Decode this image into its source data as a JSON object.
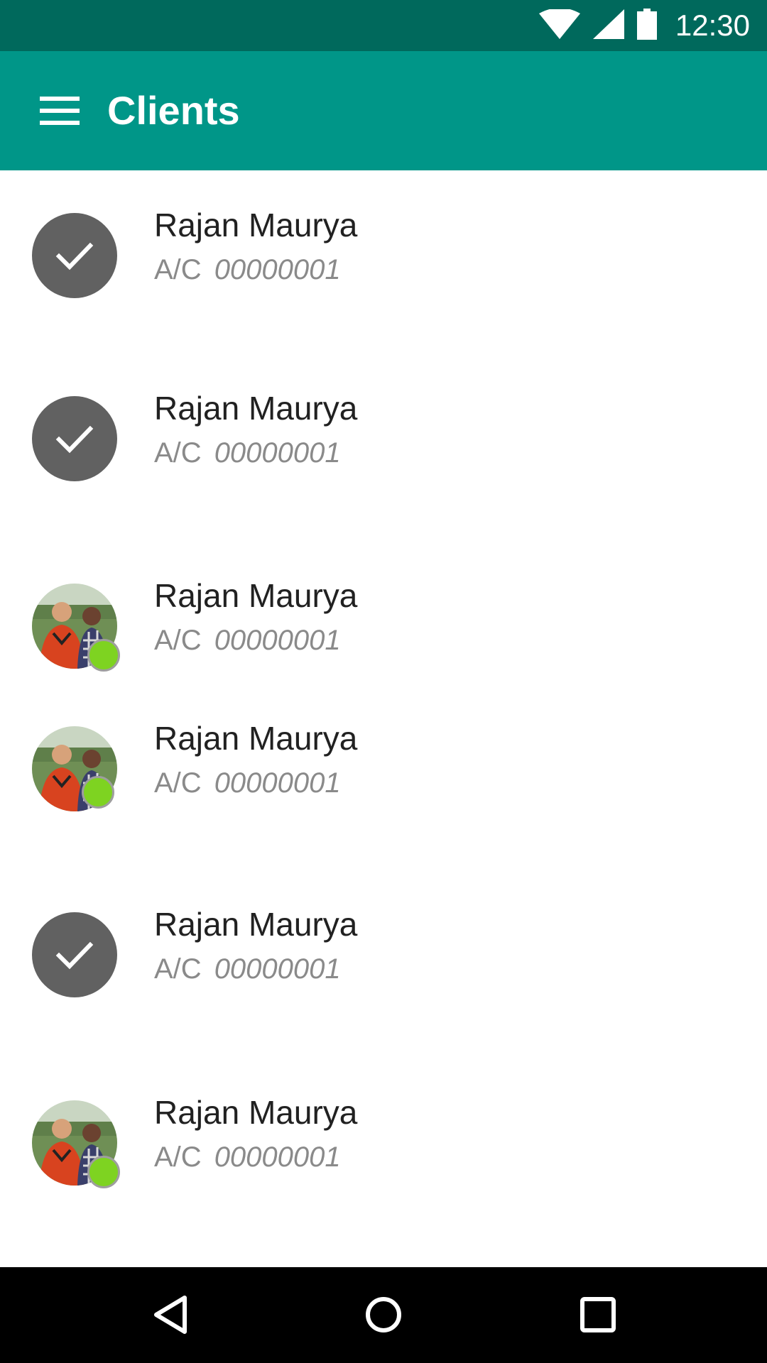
{
  "status_bar": {
    "time": "12:30",
    "icons": [
      "wifi-icon",
      "cell-signal-icon",
      "battery-icon"
    ],
    "background": "#00695C"
  },
  "app_bar": {
    "title": "Clients",
    "menu_icon": "hamburger-menu-icon",
    "background": "#009688"
  },
  "clients": [
    {
      "name": "Rajan Maurya",
      "account_label": "A/C",
      "account_number": "00000001",
      "avatar": "check",
      "online": false
    },
    {
      "name": "Rajan Maurya",
      "account_label": "A/C",
      "account_number": "00000001",
      "avatar": "check",
      "online": false
    },
    {
      "name": "Rajan Maurya",
      "account_label": "A/C",
      "account_number": "00000001",
      "avatar": "photo",
      "online": true
    },
    {
      "name": "Rajan Maurya",
      "account_label": "A/C",
      "account_number": "00000001",
      "avatar": "photo",
      "online": true
    },
    {
      "name": "Rajan Maurya",
      "account_label": "A/C",
      "account_number": "00000001",
      "avatar": "check",
      "online": false
    },
    {
      "name": "Rajan Maurya",
      "account_label": "A/C",
      "account_number": "00000001",
      "avatar": "photo",
      "online": true
    }
  ],
  "nav_bar": {
    "icons": [
      "back-icon",
      "home-icon",
      "recents-icon"
    ]
  },
  "colors": {
    "online": "#7ED321",
    "avatar_check": "#616161"
  }
}
